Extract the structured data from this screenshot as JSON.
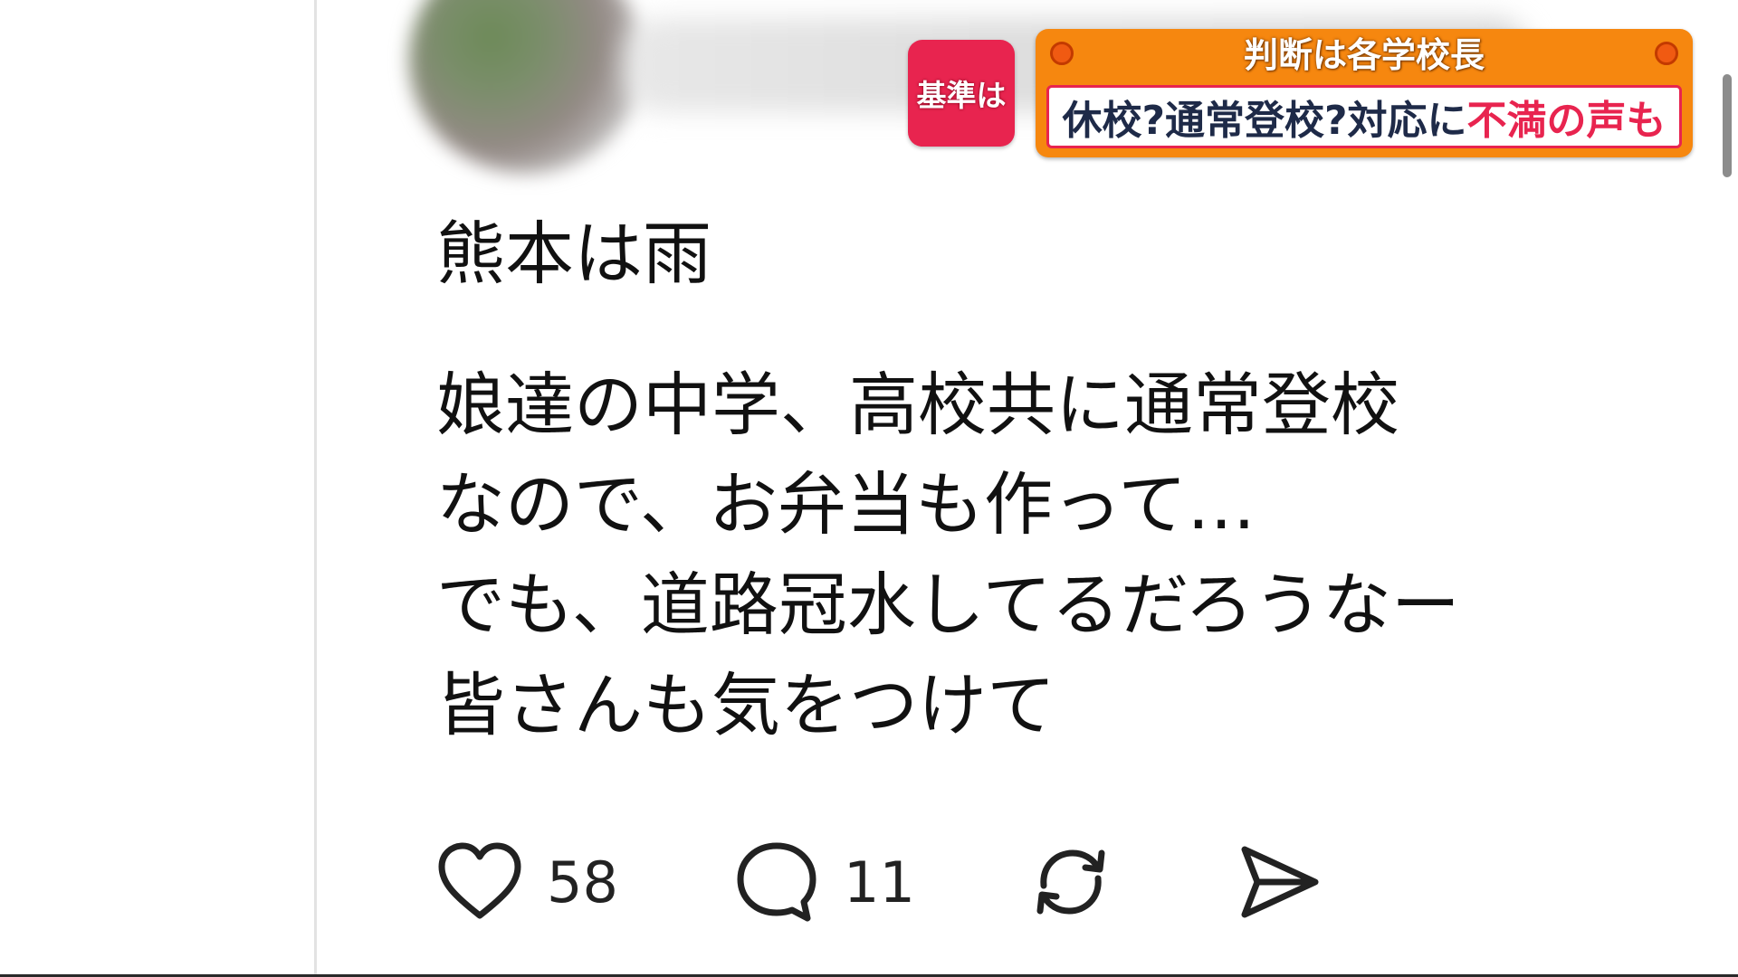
{
  "caption": {
    "tag": "基準は",
    "headline": "判断は各学校長",
    "subline_normal": "休校?通常登校?対応に",
    "subline_accent": "不満の声も"
  },
  "post": {
    "lines": [
      "熊本は雨",
      "娘達の中学、高校共に通常登校",
      "なので、お弁当も作って…",
      "でも、道路冠水してるだろうなー",
      "皆さんも気をつけて"
    ]
  },
  "actions": {
    "like_icon": "heart-icon",
    "like_count": "58",
    "reply_icon": "comment-icon",
    "reply_count": "11",
    "repost_icon": "repost-icon",
    "share_icon": "send-icon"
  },
  "colors": {
    "caption_orange": "#f6870f",
    "caption_pink": "#e8244f",
    "caption_navy": "#1e2a48",
    "text": "#111111"
  }
}
